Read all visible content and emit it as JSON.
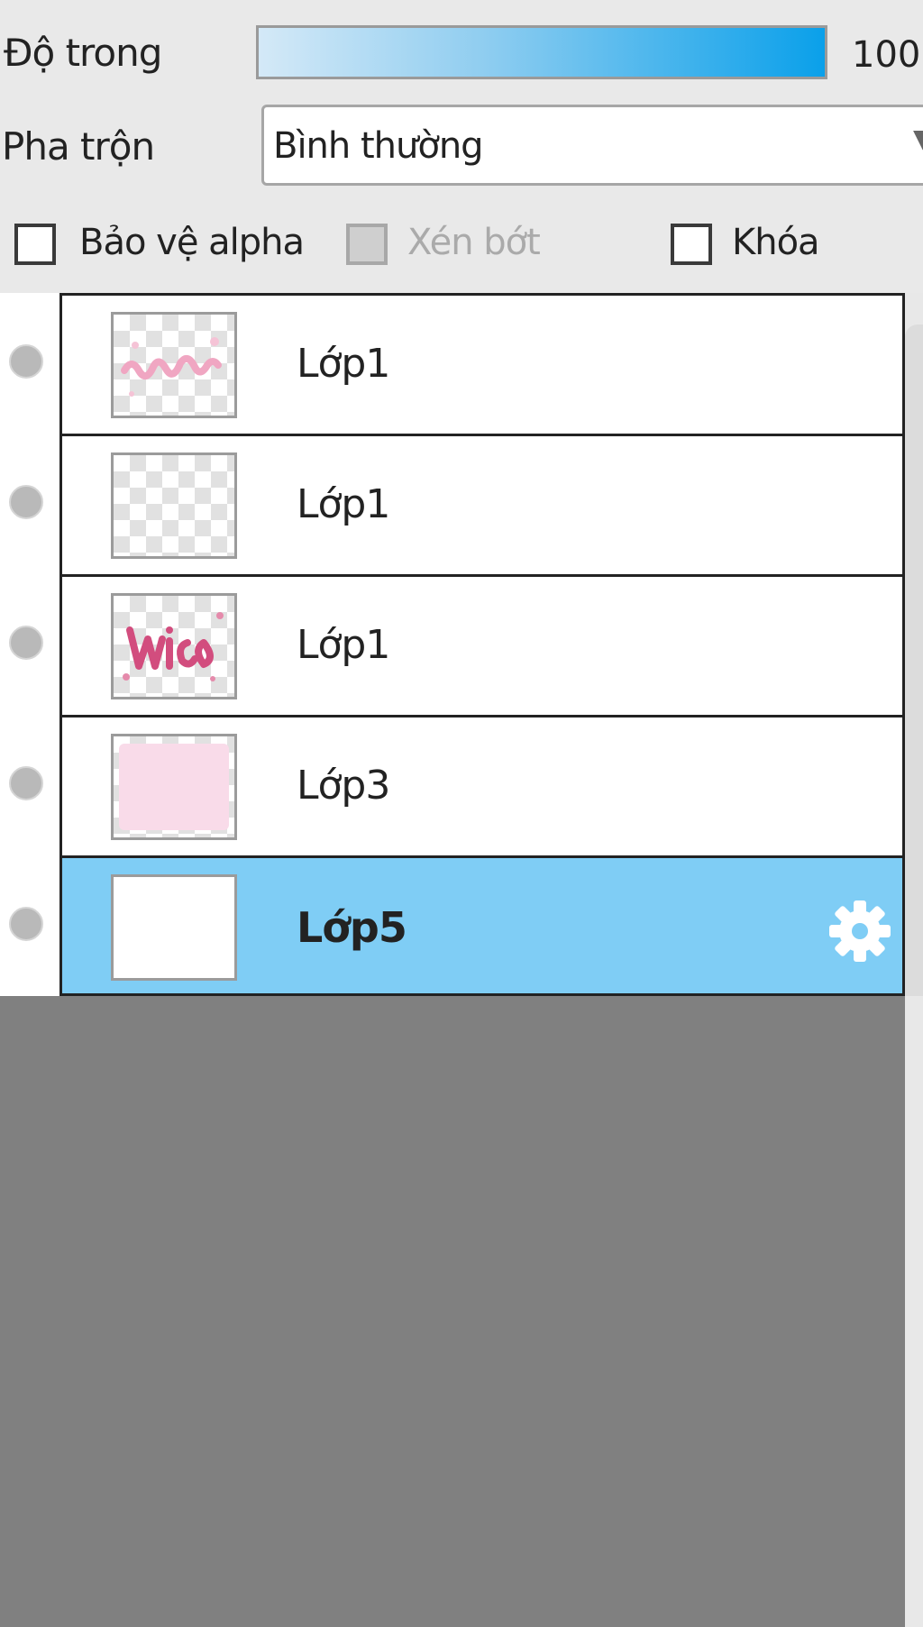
{
  "properties": {
    "opacity_label": "Độ trong",
    "opacity_value": "100",
    "opacity_fill": 1.0,
    "blend_label": "Pha trộn",
    "blend_value": "Bình thường",
    "protect_alpha_label": "Bảo vệ alpha",
    "protect_alpha_checked": false,
    "clipping_label": "Xén bớt",
    "clipping_enabled": false,
    "lock_label": "Khóa",
    "lock_checked": false
  },
  "layers": [
    {
      "name": "Lớp1",
      "thumbnail": "pink-handwriting",
      "selected": false
    },
    {
      "name": "Lớp1",
      "thumbnail": "transparent",
      "selected": false
    },
    {
      "name": "Lớp1",
      "thumbnail": "pink-lettering",
      "selected": false
    },
    {
      "name": "Lớp3",
      "thumbnail": "pink-fill",
      "selected": false
    },
    {
      "name": "Lớp5",
      "thumbnail": "white-fill",
      "selected": true,
      "icon": "gear-icon"
    }
  ],
  "colors": {
    "selected_row": "#7fcdf5",
    "accent": "#0aa0ea",
    "empty_area": "#808080"
  }
}
